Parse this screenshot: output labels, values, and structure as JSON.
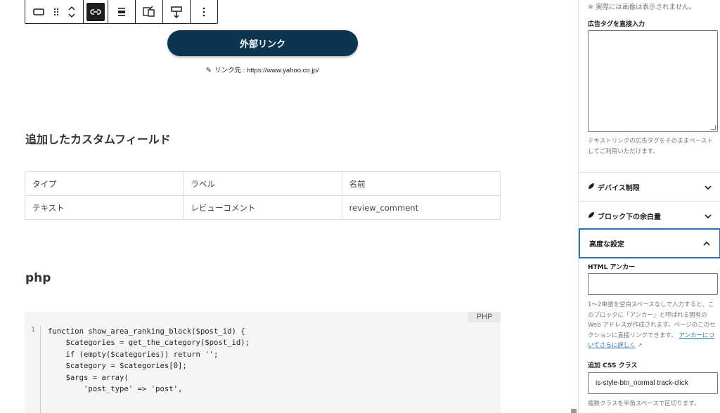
{
  "toolbar": {
    "items": [
      "block-type",
      "drag",
      "move-up-down",
      "link",
      "align",
      "swap-image",
      "insert-before",
      "more-options"
    ]
  },
  "button_block": {
    "label": "外部リンク",
    "link_prefix": "リンク先 : ",
    "link_url": "https://www.yahoo.co.jp/"
  },
  "headings": {
    "custom_fields": "追加したカスタムフィールド",
    "php": "php"
  },
  "fields_table": {
    "header": [
      "タイプ",
      "ラベル",
      "名前"
    ],
    "rows": [
      [
        "テキスト",
        "レビューコメント",
        "review_comment"
      ]
    ]
  },
  "code": {
    "language": "PHP",
    "line_numbers": [
      "1"
    ],
    "lines": [
      "function show_area_ranking_block($post_id) {",
      "    $categories = get_the_category($post_id);",
      "    if (empty($categories)) return '';",
      "",
      "    $category = $categories[0];",
      "    $args = array(",
      "        'post_type' => 'post',"
    ]
  },
  "sidebar": {
    "top_note": "※ 実際には画像は表示されません。",
    "ad_tag_label": "広告タグを直接入力",
    "ad_tag_value": "",
    "ad_tag_help": "テキストリンクの広告タグをそのままペーストしてご利用いただけます。",
    "panels": {
      "device": "デバイス制限",
      "margin": "ブロック下の余白量",
      "advanced": "高度な設定"
    },
    "anchor_label": "HTML アンカー",
    "anchor_value": "",
    "anchor_help": "1〜2単語を空白スペースなしで入力すると、このブロックに「アンカー」と呼ばれる固有の Web アドレスが作成されます。ページのこのセクションに直接リンクできます。",
    "anchor_link": "アンカーについてさらに詳しく",
    "css_label": "追加 CSS クラス",
    "css_value": "is-style-btn_normal track-click",
    "css_help": "複数クラスを半角スペースで区切ります。"
  },
  "colors": {
    "button_bg": "#0c3550",
    "focus_border": "#2f6fb7",
    "link": "#2271b1"
  }
}
